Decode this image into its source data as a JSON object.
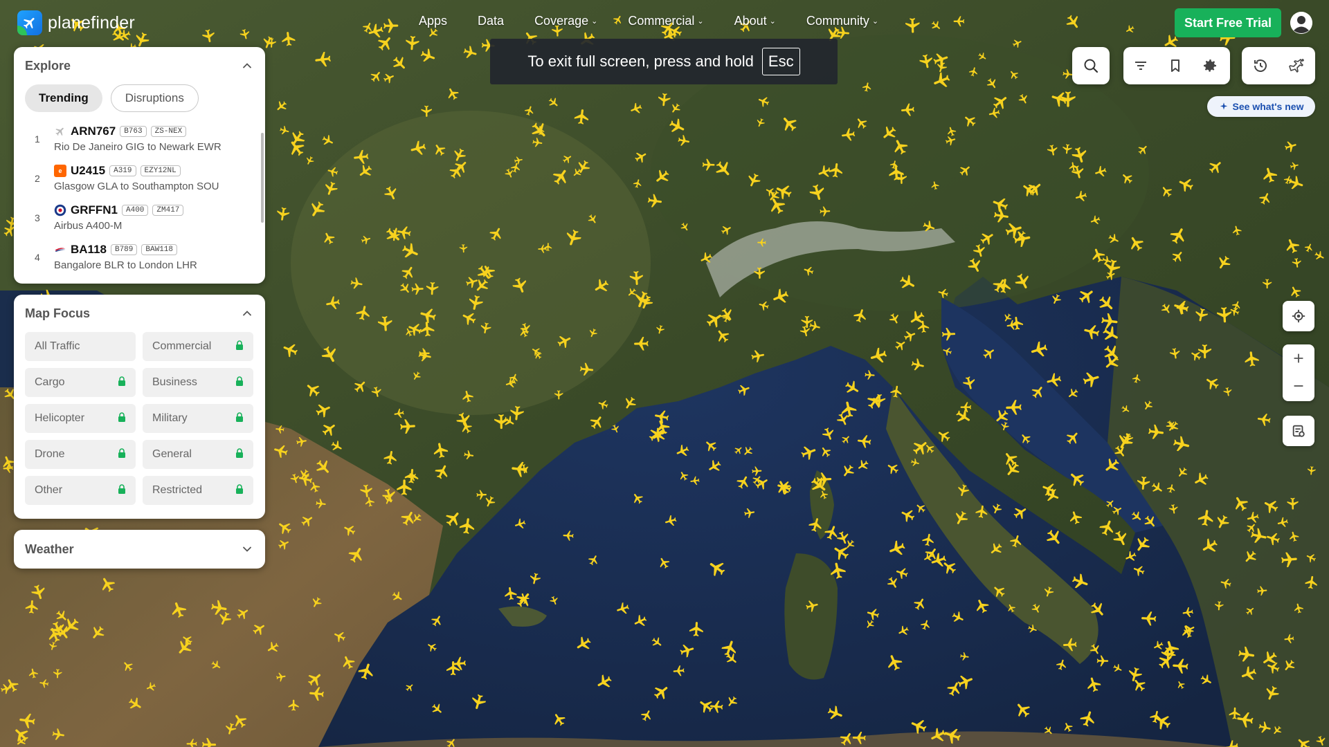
{
  "nav": {
    "logo_text": "planefinder",
    "links": [
      {
        "label": "Apps",
        "dropdown": false
      },
      {
        "label": "Data",
        "dropdown": false
      },
      {
        "label": "Coverage",
        "dropdown": true
      },
      {
        "label": "Commercial",
        "dropdown": true
      },
      {
        "label": "About",
        "dropdown": true
      },
      {
        "label": "Community",
        "dropdown": true
      }
    ],
    "trial_button": "Start Free Trial"
  },
  "fullscreen_banner": {
    "text": "To exit full screen, press and hold",
    "key": "Esc"
  },
  "whats_new": "See what's new",
  "explore": {
    "title": "Explore",
    "tabs": [
      {
        "label": "Trending",
        "active": true
      },
      {
        "label": "Disruptions",
        "active": false
      }
    ],
    "items": [
      {
        "rank": "1",
        "callsign": "ARN767",
        "type": "B763",
        "reg": "ZS-NEX",
        "route": "Rio De Janeiro GIG to Newark EWR",
        "icon": "generic-plane-icon",
        "icon_color": "#b8b8b8"
      },
      {
        "rank": "2",
        "callsign": "U2415",
        "type": "A319",
        "reg": "EZY12NL",
        "route": "Glasgow GLA to Southampton SOU",
        "icon": "easyjet-icon",
        "icon_color": "#ff6600"
      },
      {
        "rank": "3",
        "callsign": "GRFFN1",
        "type": "A400",
        "reg": "ZM417",
        "route": "Airbus A400-M",
        "icon": "roundel-icon",
        "icon_color": "#1b3a8a"
      },
      {
        "rank": "4",
        "callsign": "BA118",
        "type": "B789",
        "reg": "BAW118",
        "route": "Bangalore BLR to London LHR",
        "icon": "ba-speedmarque-icon",
        "icon_color": "#d0112b"
      }
    ]
  },
  "map_focus": {
    "title": "Map Focus",
    "options": [
      {
        "label": "All Traffic",
        "locked": false
      },
      {
        "label": "Commercial",
        "locked": true
      },
      {
        "label": "Cargo",
        "locked": true
      },
      {
        "label": "Business",
        "locked": true
      },
      {
        "label": "Helicopter",
        "locked": true
      },
      {
        "label": "Military",
        "locked": true
      },
      {
        "label": "Drone",
        "locked": true
      },
      {
        "label": "General",
        "locked": true
      },
      {
        "label": "Other",
        "locked": true
      },
      {
        "label": "Restricted",
        "locked": true
      }
    ]
  },
  "weather": {
    "title": "Weather"
  },
  "colors": {
    "plane": "#f7d21e",
    "accent_green": "#18b15a",
    "lock_green": "#18b15a",
    "sea": "#1c2f4d",
    "land": "#3c4a2a"
  }
}
